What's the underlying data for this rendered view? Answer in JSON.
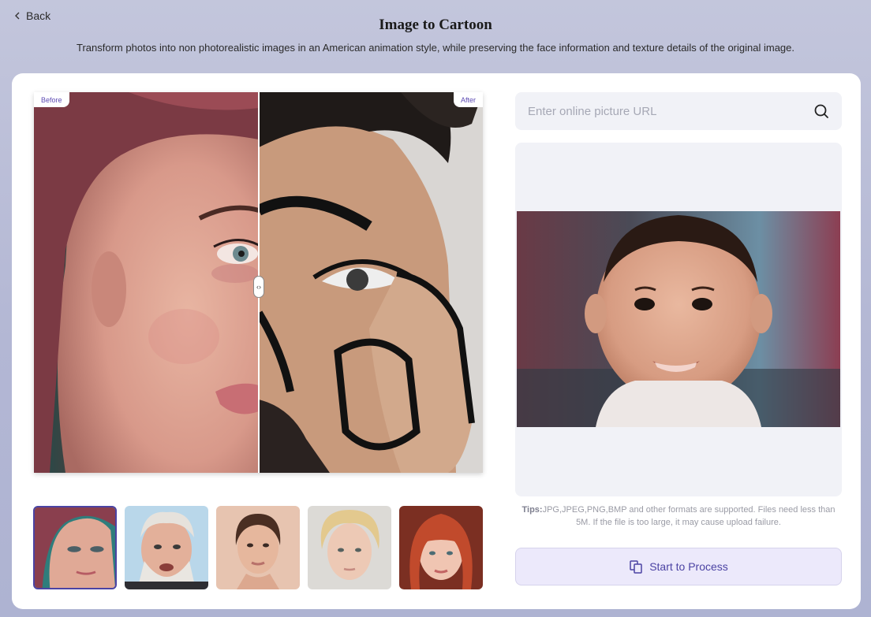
{
  "header": {
    "back_label": "Back",
    "title": "Image to Cartoon",
    "subtitle": "Transform photos into non photorealistic images in an American animation style, while preserving the face information and texture details of the original image."
  },
  "compare": {
    "before_label": "Before",
    "after_label": "After",
    "handle_glyph": "‹›"
  },
  "thumbnails": [
    {
      "id": "woman-redhair-1",
      "active": true
    },
    {
      "id": "old-man",
      "active": false
    },
    {
      "id": "young-woman",
      "active": false
    },
    {
      "id": "blond-boy",
      "active": false
    },
    {
      "id": "redhead-woman",
      "active": false
    }
  ],
  "search": {
    "placeholder": "Enter online picture URL",
    "icon": "search-icon"
  },
  "tips": {
    "label": "Tips:",
    "text": "JPG,JPEG,PNG,BMP and other formats are supported. Files need less than 5M. If the file is too large, it may cause upload failure."
  },
  "process": {
    "label": "Start to Process",
    "icon": "copy-icon"
  },
  "colors": {
    "accent": "#4b43a3",
    "panel": "#f1f2f7",
    "button_bg": "#ece9fb"
  }
}
